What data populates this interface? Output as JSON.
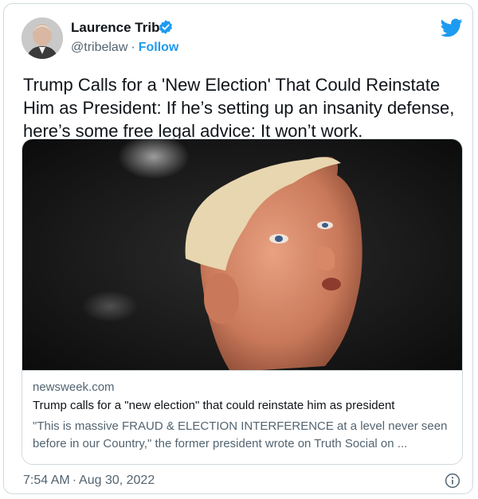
{
  "author": {
    "name": "Laurence Tribe",
    "handle": "@tribelaw",
    "separator": "·",
    "follow_label": "Follow"
  },
  "tweet": {
    "text": "Trump Calls for a 'New Election' That Could Reinstate Him as President: If he’s setting up an insanity defense, here’s some free legal advice: It won’t work."
  },
  "link_card": {
    "domain": "newsweek.com",
    "title": "Trump calls for a \"new election\" that could reinstate him as president",
    "description": "\"This is massive FRAUD & ELECTION INTERFERENCE at a level never seen before in our Country,\" the former president wrote on Truth Social on ..."
  },
  "footer": {
    "time": "7:54 AM",
    "separator": "·",
    "date": "Aug 30, 2022"
  },
  "icons": {
    "verified": "verified-badge-icon",
    "brand": "twitter-bird-icon",
    "info": "info-icon"
  },
  "colors": {
    "accent": "#1d9bf0",
    "text": "#0f1419",
    "secondary": "#536471",
    "border": "#cfd9de"
  }
}
